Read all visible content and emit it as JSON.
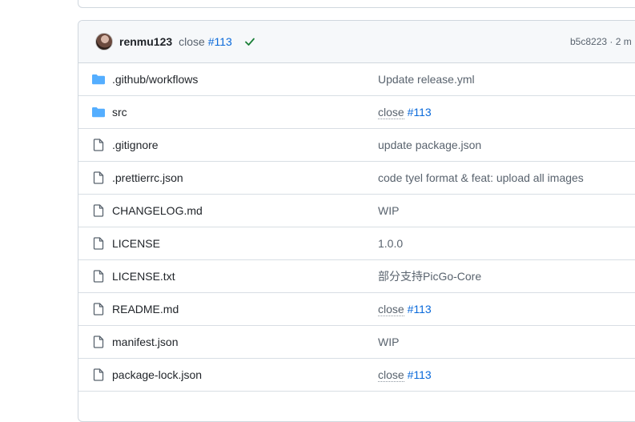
{
  "latest_commit": {
    "author": "renmu123",
    "message": "close",
    "issue": "#113",
    "sha_age": "b5c8223 · 2 m"
  },
  "files": [
    {
      "name": ".github/workflows",
      "type": "folder",
      "msg": "Update release.yml",
      "issue": ""
    },
    {
      "name": "src",
      "type": "folder",
      "msg": "close",
      "issue": "#113"
    },
    {
      "name": ".gitignore",
      "type": "file",
      "msg": "update package.json",
      "issue": ""
    },
    {
      "name": ".prettierrc.json",
      "type": "file",
      "msg": "code tyel format & feat: upload all images",
      "issue": ""
    },
    {
      "name": "CHANGELOG.md",
      "type": "file",
      "msg": "WIP",
      "issue": ""
    },
    {
      "name": "LICENSE",
      "type": "file",
      "msg": "1.0.0",
      "issue": ""
    },
    {
      "name": "LICENSE.txt",
      "type": "file",
      "msg": "部分支持PicGo-Core",
      "issue": ""
    },
    {
      "name": "README.md",
      "type": "file",
      "msg": "close",
      "issue": "#113"
    },
    {
      "name": "manifest.json",
      "type": "file",
      "msg": "WIP",
      "issue": ""
    },
    {
      "name": "package-lock.json",
      "type": "file",
      "msg": "close",
      "issue": "#113"
    }
  ],
  "colors": {
    "folder": "#54aeff",
    "link": "#0969da",
    "check": "#1a7f37"
  }
}
